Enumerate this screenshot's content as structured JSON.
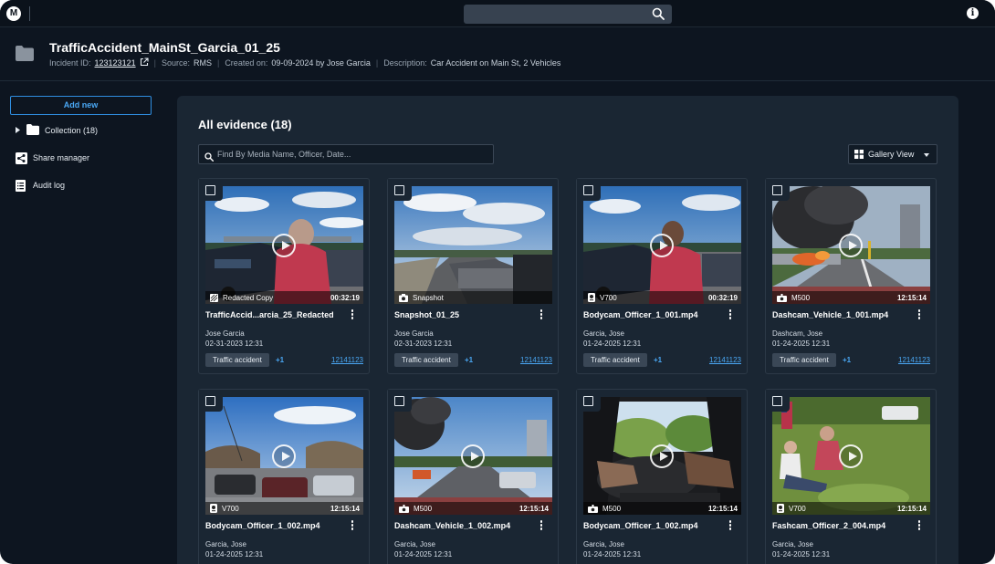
{
  "app": {
    "logo_glyph": "M",
    "info_glyph": "i"
  },
  "incident": {
    "title": "TrafficAccident_MainSt_Garcia_01_25",
    "id_label": "Incident ID:",
    "id_value": "123123121",
    "source_label": "Source:",
    "source_value": "RMS",
    "created_label": "Created on:",
    "created_value": "09-09-2024 by Jose Garcia",
    "description_label": "Description:",
    "description_value": "Car Accident on Main St, 2 Vehicles"
  },
  "sidebar": {
    "add_new": "Add new",
    "collection": "Collection (18)",
    "share_manager": "Share manager",
    "audit_log": "Audit log"
  },
  "main": {
    "title": "All evidence (18)",
    "search_placeholder": "Find By Media Name, Officer, Date...",
    "view_label": "Gallery View"
  },
  "cards": [
    {
      "title": "TrafficAccid...arcia_25_Redacted",
      "owner": "Jose Garcia",
      "date": "02-31-2023  12:31",
      "source": "Redacted Copy",
      "source_icon": "redacted-icon",
      "duration": "00:32:19",
      "tag": "Traffic accident",
      "more": "+1",
      "incident": "12141123"
    },
    {
      "title": "Snapshot_01_25",
      "owner": "Jose Garcia",
      "date": "02-31-2023  12:31",
      "source": "Snapshot",
      "source_icon": "camera-icon",
      "duration": "",
      "tag": "Traffic accident",
      "more": "+1",
      "incident": "12141123"
    },
    {
      "title": "Bodycam_Officer_1_001.mp4",
      "owner": "Garcia, Jose",
      "date": "01-24-2025  12:31",
      "source": "V700",
      "source_icon": "bodycam-icon",
      "duration": "00:32:19",
      "tag": "Traffic accident",
      "more": "+1",
      "incident": "12141123"
    },
    {
      "title": "Dashcam_Vehicle_1_001.mp4",
      "owner": "Dashcam, Jose",
      "date": "01-24-2025  12:31",
      "source": "M500",
      "source_icon": "dashcam-icon",
      "duration": "12:15:14",
      "tag": "Traffic accident",
      "more": "+1",
      "incident": "12141123"
    },
    {
      "title": "Bodycam_Officer_1_002.mp4",
      "owner": "Garcia, Jose",
      "date": "01-24-2025  12:31",
      "source": "V700",
      "source_icon": "bodycam-icon",
      "duration": "12:15:14"
    },
    {
      "title": "Dashcam_Vehicle_1_002.mp4",
      "owner": "Garcia, Jose",
      "date": "01-24-2025  12:31",
      "source": "M500",
      "source_icon": "dashcam-icon",
      "duration": "12:15:14"
    },
    {
      "title": "Bodycam_Officer_1_002.mp4",
      "owner": "Garcia, Jose",
      "date": "01-24-2025  12:31",
      "source": "M500",
      "source_icon": "dashcam-icon",
      "duration": "12:15:14"
    },
    {
      "title": "Fashcam_Officer_2_004.mp4",
      "owner": "Garcia, Jose",
      "date": "01-24-2025  12:31",
      "source": "V700",
      "source_icon": "bodycam-icon",
      "duration": "12:15:14"
    }
  ]
}
